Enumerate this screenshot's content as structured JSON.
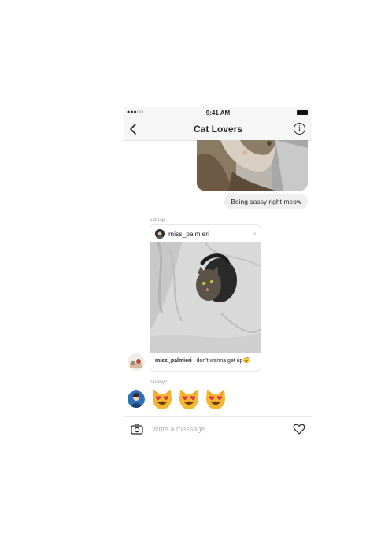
{
  "status_bar": {
    "signal": "●●●○○",
    "time": "9:41 AM"
  },
  "header": {
    "title": "Cat Lovers",
    "back_icon": "chevron-left-icon",
    "info_icon": "info-icon",
    "info_glyph": "i"
  },
  "messages": {
    "sent_photo_icon": "cat-photo",
    "sent_text": "Being sassy right meow",
    "shared_post": {
      "sender": "catnap",
      "username": "miss_palmieri",
      "caption_user": "miss_palmieri",
      "caption_text": " I don't wanna get up😴",
      "chevron": "›"
    },
    "emoji_message": {
      "sender": "ninanyc",
      "emoji": "smiling-cat-heart-eyes x3"
    }
  },
  "composer": {
    "placeholder": "Write a message...",
    "camera_icon": "camera-icon",
    "heart_icon": "heart-icon"
  },
  "colors": {
    "bubble": "#efefef",
    "divider": "#e6e6e6",
    "text": "#262626",
    "muted": "#999999"
  }
}
